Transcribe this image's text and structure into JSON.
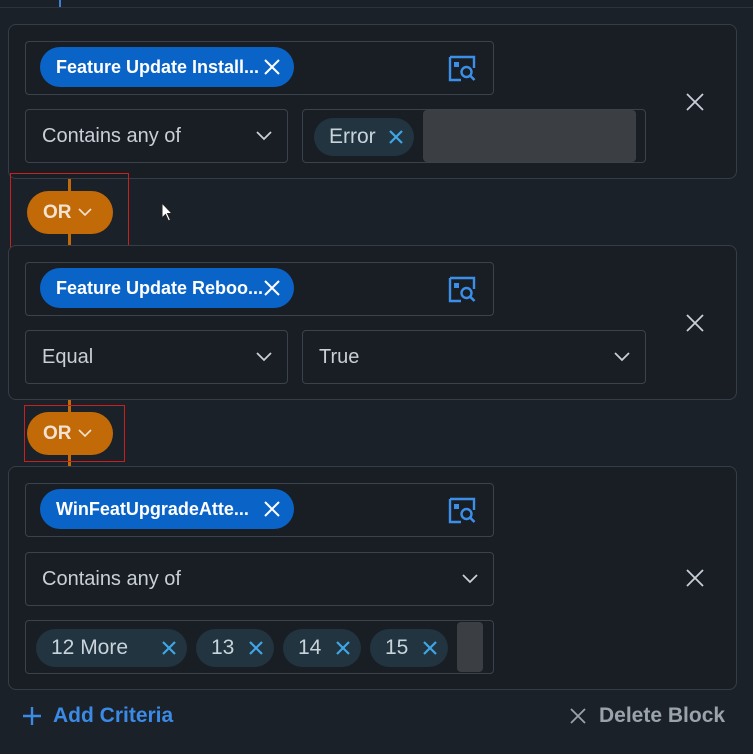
{
  "criteria": [
    {
      "field": "Feature Update Install...",
      "operator": "Contains any of",
      "values": [
        "Error"
      ]
    },
    {
      "field": "Feature Update Reboo...",
      "operator": "Equal",
      "value": "True"
    },
    {
      "field": "WinFeatUpgradeAtte...",
      "operator": "Contains any of",
      "values": [
        "12 More",
        "13",
        "14",
        "15"
      ]
    }
  ],
  "connectors": [
    "OR",
    "OR"
  ],
  "footer": {
    "add_label": "Add Criteria",
    "delete_label": "Delete Block"
  },
  "colors": {
    "background": "#1b2128",
    "field_pill": "#0a64c8",
    "connector": "#c26a08",
    "value_chip": "#21343f",
    "link": "#3a8ae6",
    "highlight_box": "#c8201e"
  }
}
